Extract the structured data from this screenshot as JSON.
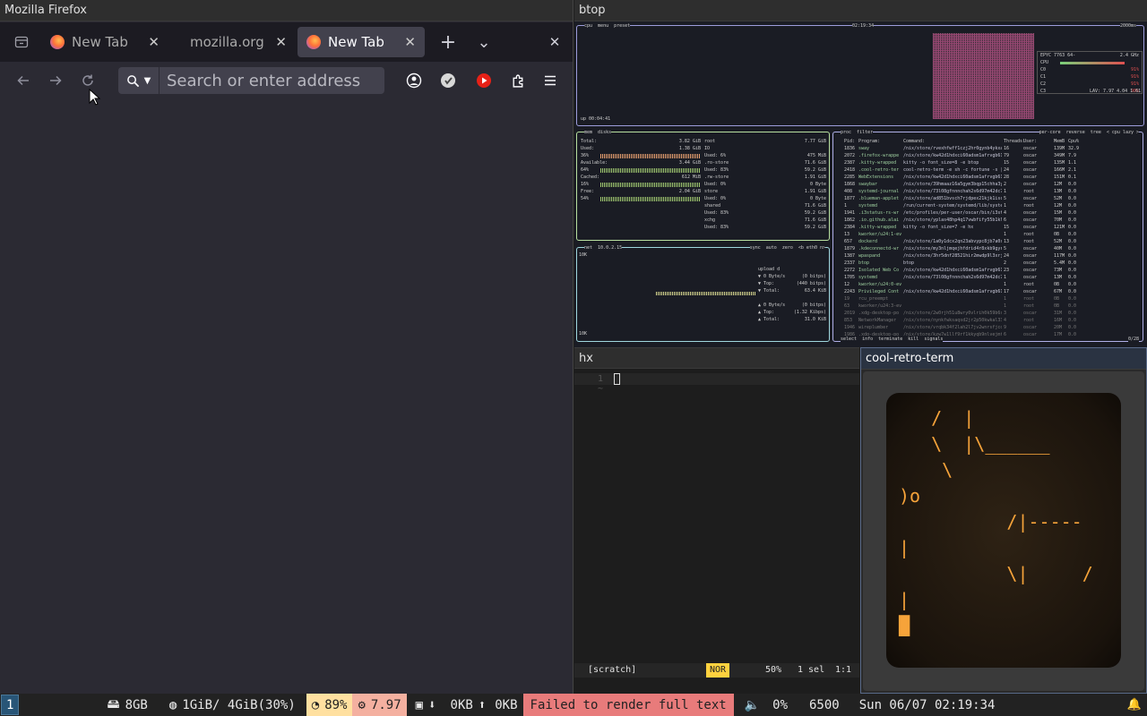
{
  "firefox": {
    "window_title": "Mozilla Firefox",
    "tabs": [
      {
        "label": "New Tab",
        "selected": false
      },
      {
        "label": "mozilla.org",
        "selected": false
      },
      {
        "label": "New Tab",
        "selected": true
      }
    ],
    "new_tab_glyph": "+",
    "list_tabs_glyph": "⌄",
    "close_glyph": "✕",
    "urlbar_placeholder": "Search or enter address"
  },
  "btop": {
    "window_title": "btop",
    "cpu": {
      "header": "cpu  menu  preset",
      "clock": "02:19:34",
      "refresh": "2000ms",
      "uptime": "up 00:04:41",
      "model": "EPYC 7763 64-",
      "freq": "2.4 GHz",
      "cpu_total": "CPU",
      "cores": [
        {
          "label": "C0",
          "pct": "91%"
        },
        {
          "label": "C1",
          "pct": "91%"
        },
        {
          "label": "C2",
          "pct": "91%"
        },
        {
          "label": "C3",
          "pct": "90%"
        }
      ],
      "load_avg": "LAV: 7.97 4.04 1.61"
    },
    "mem": {
      "header": "mem  disks",
      "rows": [
        {
          "label": "Total:",
          "value": "3.82 GiB"
        },
        {
          "label": "Used:",
          "value": "1.38 GiB"
        },
        {
          "label": "36%",
          "value": ""
        },
        {
          "label": "Available:",
          "value": "3.44 GiB"
        },
        {
          "label": "64%",
          "value": ""
        },
        {
          "label": "Cached:",
          "value": "612 MiB"
        },
        {
          "label": "16%",
          "value": ""
        },
        {
          "label": "Free:",
          "value": "2.04 GiB"
        },
        {
          "label": "54%",
          "value": ""
        }
      ],
      "disks": [
        {
          "name": "root",
          "total": "7.77 GiB"
        },
        {
          "name": "IO",
          "total": ""
        },
        {
          "name": "Used: 6%",
          "total": "475 MiB"
        },
        {
          "name": ".ro-store",
          "total": "71.6 GiB"
        },
        {
          "name": "Used: 83%",
          "total": "59.2 GiB"
        },
        {
          "name": ".rw-store",
          "total": "1.91 GiB"
        },
        {
          "name": "Used: 0%",
          "total": "0 Byte"
        },
        {
          "name": "store",
          "total": "1.91 GiB"
        },
        {
          "name": "Used: 0%",
          "total": "0 Byte"
        },
        {
          "name": "shared",
          "total": "71.6 GiB"
        },
        {
          "name": "Used: 83%",
          "total": "59.2 GiB"
        },
        {
          "name": "xchg",
          "total": "71.6 GiB"
        },
        {
          "name": "Used: 83%",
          "total": "59.2 GiB"
        }
      ]
    },
    "net": {
      "header": "net  10.0.2.15",
      "controls": "sync  auto  zero  <b eth0 n>",
      "scale_top": "10K",
      "scale_bottom": "10K",
      "rows": [
        {
          "label": "upload d",
          "value": ""
        },
        {
          "label": "▼ 0 Byte/s",
          "value": "(0 bitps)"
        },
        {
          "label": "▼ Top:",
          "value": "(440 bitps)"
        },
        {
          "label": "▼ Total:",
          "value": "63.4 KiB"
        },
        {
          "label": "▲ 0 Byte/s",
          "value": "(0 bitps)"
        },
        {
          "label": "▲ Top:",
          "value": "(1.32 Kibps)"
        },
        {
          "label": "▲ Total:",
          "value": "31.0 KiB"
        }
      ]
    },
    "proc": {
      "header": "proc  filter",
      "options": "per-core  reverse  tree  < cpu lazy >",
      "columns": [
        "Pid:",
        "Program:",
        "Command:",
        "Threads:",
        "User:",
        "MemB",
        "Cpu%"
      ],
      "rows": [
        [
          "1836",
          "sway",
          "/nix/store/rvexhfwff1czj2hr0gynb4ykxa1klzfh-sway-unwra",
          "16",
          "oscar",
          "139M",
          "32.9"
        ],
        [
          "2072",
          ".firefox-wrappe",
          "/nix/store/kw42d1hdxci60adsm1afrvgb618xzy6-firefox-14",
          "79",
          "oscar",
          "349M",
          "7.9"
        ],
        [
          "2387",
          ".kitty-wrapped",
          "kitty -o font_size=8 -e btop",
          "15",
          "oscar",
          "135M",
          "1.1"
        ],
        [
          "2418",
          ".cool-retro-ter",
          "cool-retro-term -e sh -c fortune -s | cowsay -r; sleep",
          "24",
          "oscar",
          "166M",
          "2.1"
        ],
        [
          "2285",
          "WebExtensions",
          "/nix/store/kw42d1hdxci60adsm1afrvgb618xzy6-firefox-14",
          "28",
          "oscar",
          "151M",
          "0.1"
        ],
        [
          "1868",
          "swaybar",
          "/nix/store/39hmaaz16a5gym3bqp15chha3y90a1ix-sway-1.11/",
          "2",
          "oscar",
          "12M",
          "0.0"
        ],
        [
          "408",
          "systemd-journal",
          "/nix/store/73l08gfnnnchah2s6d97m42dc71dv4vs-systemd-25",
          "1",
          "root",
          "13M",
          "0.0"
        ],
        [
          "1877",
          ".blueman-applet",
          "/nix/store/ad851bvsch7rjdpex21kjk1iscbj5wlvs-python3-3.",
          "5",
          "oscar",
          "52M",
          "0.0"
        ],
        [
          "1",
          "systemd",
          "/run/current-system/systemd/lib/systemd/systemd",
          "1",
          "root",
          "12M",
          "0.0"
        ],
        [
          "1941",
          ".i3status-rs-wr",
          "/etc/profiles/per-user/oscar/bin/i3status-rs config-bo",
          "4",
          "oscar",
          "15M",
          "0.0"
        ],
        [
          "1862",
          ".io.github.alai",
          "/nix/store/yplas48hp4q17vwbfify55b1klx1qxp8a-planify-4.",
          "6",
          "oscar",
          "70M",
          "0.0"
        ],
        [
          "2384",
          ".kitty-wrapped",
          "kitty -o font_size=7 -e hx",
          "15",
          "oscar",
          "121M",
          "0.0"
        ],
        [
          "13",
          "kworker/u24:1-ev",
          "",
          "1",
          "root",
          "0B",
          "0.0"
        ],
        [
          "657",
          "dockerd",
          "/nix/store/1a0y1dcx2qn23abvypc8jb7a0s3p1drg-moby-28.2.",
          "13",
          "root",
          "52M",
          "0.0"
        ],
        [
          "1879",
          ".kdeconnectd-wr",
          "/nix/store/my3nljmqejhfdrid4r8xkb9gyrgv1rdv-kdeconnect",
          "5",
          "oscar",
          "40M",
          "0.0"
        ],
        [
          "1387",
          "wpaspand",
          "/nix/store/3hr5dnf28521hir2mwdp9l3xrjv7gplai-wpaspand-1.",
          "24",
          "oscar",
          "117M",
          "0.0"
        ],
        [
          "2337",
          "btop",
          "btop",
          "2",
          "oscar",
          "5.4M",
          "0.0"
        ],
        [
          "2272",
          "Isolated Web Co",
          "/nix/store/kw42d1hdxci60adsm1afrvgb618xzy6-firefox-14",
          "23",
          "oscar",
          "73M",
          "0.0"
        ],
        [
          "1705",
          "systemd",
          "/nix/store/73l08gfnnnchah2s6d97m42dc71dv4vs-systemd-25",
          "1",
          "oscar",
          "13M",
          "0.0"
        ],
        [
          "12",
          "kworker/u24:0-ev",
          "",
          "1",
          "root",
          "0B",
          "0.0"
        ],
        [
          "2243",
          "Privileged Cont",
          "/nix/store/kw42d1hdxci60adsm1afrvgb618xzy6-firefox-14",
          "17",
          "oscar",
          "67M",
          "0.0"
        ],
        [
          "19",
          "rcu_preempt",
          "",
          "1",
          "root",
          "0B",
          "0.0"
        ],
        [
          "63",
          "kworker/u24:3-ev",
          "",
          "1",
          "root",
          "0B",
          "0.0"
        ],
        [
          "2019",
          ".xdg-desktop-po",
          "/nix/store/2w0rjh51u8wry0vlrih0k59b6sa0-xdg-deskto",
          "3",
          "oscar",
          "31M",
          "0.0"
        ],
        [
          "853",
          "NetworkManager",
          "/nix/store/nynkfwksaqsd2jr2p50kwkal33rff5wb-networkman",
          "4",
          "root",
          "16M",
          "0.0"
        ],
        [
          "1946",
          "wireplumber",
          "/nix/store/vrqbk34f2lah2l7jv2wnrsfjcqs8rmb-wireplumbe",
          "9",
          "oscar",
          "20M",
          "0.0"
        ],
        [
          "1986",
          ".xdg-desktop-po",
          "/nix/store/kzw7w1llf9rf1kkyqb9nlvejmf9jxz5z-xdg-deskto",
          "6",
          "oscar",
          "17M",
          "0.0"
        ]
      ],
      "footer": "select  info  terminate  kill  signals",
      "count": "0/28"
    }
  },
  "hx": {
    "window_title": "hx",
    "line_number": "1",
    "tilde": "~",
    "status_buffer": "[scratch]",
    "status_mode": "NOR",
    "status_pct": "50%",
    "status_sel": "1 sel",
    "status_pos": "1:1"
  },
  "crt": {
    "window_title": "cool-retro-term",
    "lines": [
      "   /  |",
      "   \\  |\\______",
      "    \\",
      ")o",
      "          /|-----",
      "|",
      "          \\|     /",
      "|",
      "█"
    ]
  },
  "statusbar": {
    "workspace": "1",
    "disk": "8GB",
    "mem": "1GiB/ 4GiB(30%)",
    "cpu": "89%",
    "load": "7.97",
    "net_down": "0KB",
    "net_up": "0KB",
    "error": "Failed to render full text",
    "volume": "0%",
    "backlight": "6500",
    "datetime": "Sun 06/07 02:19:34"
  },
  "colors": {
    "btop_cpu_border": "#9d9ddc",
    "btop_mem_border": "#b8e0a0",
    "btop_net_border": "#a0d8e0",
    "btop_proc_border": "#b0b0e8",
    "crt_amber": "#f6a33a",
    "hx_mode_bg": "#ffd23f",
    "statusbar_warn": "#ffe0a0",
    "statusbar_error": "#e87b7b",
    "statusbar_load": "#f4b0a0",
    "workspace_focused": "#285577"
  }
}
